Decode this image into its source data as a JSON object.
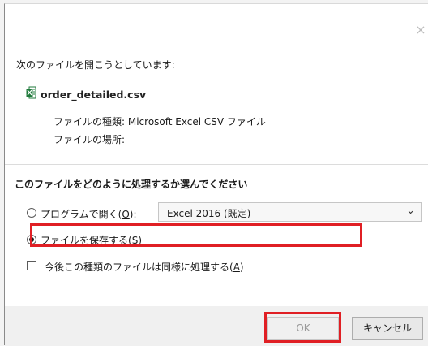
{
  "dialog": {
    "close_icon": "×",
    "intro_text": "次のファイルを開こうとしています:",
    "file_name": "order_detailed.csv",
    "file_type_label": "ファイルの種類: Microsoft Excel CSV ファイル",
    "file_location_label": "ファイルの場所:",
    "question": "このファイルをどのように処理するか選んでください",
    "open_with_prefix": "プログラムで開く(",
    "open_with_mnemonic": "O",
    "open_with_suffix": "):",
    "program_select_value": "Excel 2016 (既定)",
    "program_select_arrow": "⌄",
    "save_prefix": "ファイルを保存する(",
    "save_mnemonic": "S",
    "save_suffix": ")",
    "remember_prefix": "今後この種類のファイルは同様に処理する(",
    "remember_mnemonic": "A",
    "remember_suffix": ")",
    "ok_label": "OK",
    "cancel_label": "キャンセル"
  },
  "icons": {
    "file_icon": "excel-csv-icon"
  },
  "colors": {
    "highlight": "#e01f24",
    "excel_green": "#1f7a3b"
  },
  "state": {
    "selected_option": "save",
    "remember_checked": false,
    "ok_enabled": false
  }
}
